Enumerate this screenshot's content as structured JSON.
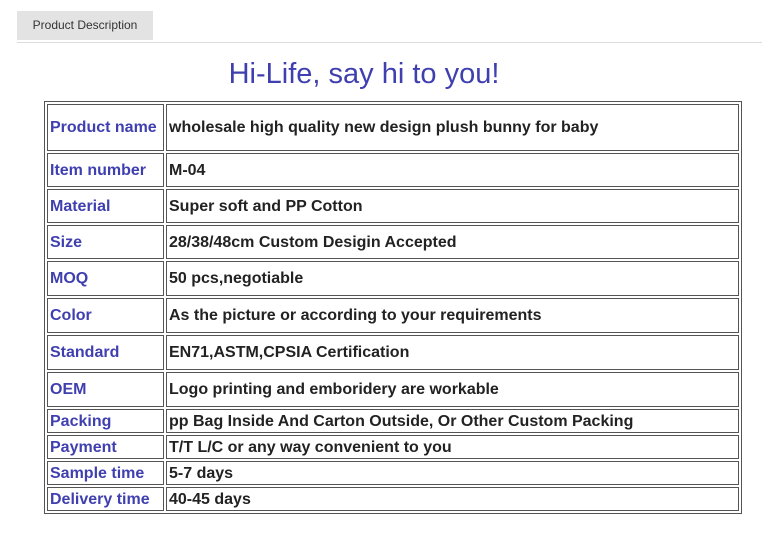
{
  "tabs": [
    {
      "label": "Product Description"
    }
  ],
  "headline": "Hi-Life, say hi to you!",
  "colors": {
    "label_text": "#3f3fb0",
    "value_text": "#222222",
    "tab_bg": "#e3e3e3"
  },
  "specs": [
    {
      "label": "Product name",
      "value": "wholesale high quality new design plush bunny for baby"
    },
    {
      "label": "Item number",
      "value": "M-04"
    },
    {
      "label": "Material",
      "value": "Super soft and PP Cotton"
    },
    {
      "label": "Size",
      "value": "28/38/48cm Custom Desigin Accepted"
    },
    {
      "label": "MOQ",
      "value": "50 pcs,negotiable"
    },
    {
      "label": "Color",
      "value": "As the picture or according to your requirements"
    },
    {
      "label": "Standard",
      "value": "EN71,ASTM,CPSIA Certification"
    },
    {
      "label": "OEM",
      "value": "Logo printing and emboridery are workable"
    },
    {
      "label": "Packing",
      "value": "pp Bag Inside And Carton Outside, Or Other Custom Packing"
    },
    {
      "label": "Payment",
      "value": "T/T L/C or any way convenient to you"
    },
    {
      "label": "Sample time",
      "value": "5-7 days"
    },
    {
      "label": "Delivery time",
      "value": "40-45 days"
    }
  ]
}
